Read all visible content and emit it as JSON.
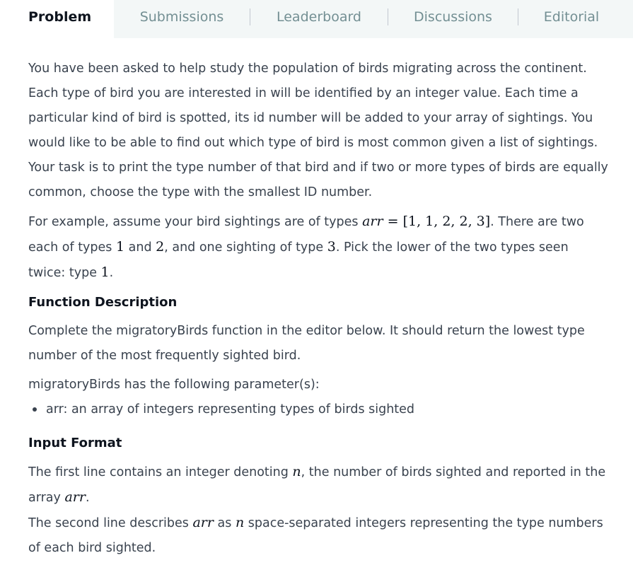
{
  "tabs": {
    "problem": "Problem",
    "submissions": "Submissions",
    "leaderboard": "Leaderboard",
    "discussions": "Discussions",
    "editorial": "Editorial"
  },
  "statement": {
    "intro": "You have been asked to help study the population of birds migrating across the continent. Each type of bird you are interested in will be identified by an integer value. Each time a particular kind of bird is spotted, its id number will be added to your array of sightings. You would like to be able to find out which type of bird is most common given a list of sightings. Your task is to print the type number of that bird and if two or more types of birds are equally common, choose the type with the smallest ID number.",
    "example": {
      "t1": "For example, assume your bird sightings are of types ",
      "var_arr": "arr",
      "eq": " = ",
      "arr_value": "[1, 1, 2, 2, 3]",
      "t2": ". There are two each of types ",
      "n1": "1",
      "t3": " and ",
      "n2": "2",
      "t4": ", and one sighting of type ",
      "n3": "3",
      "t5": ". Pick the lower of the two types seen twice: type ",
      "n4": "1",
      "t6": "."
    }
  },
  "function_description": {
    "heading": "Function Description",
    "text": "Complete the migratoryBirds function in the editor below. It should return the lowest type number of the most frequently sighted bird.",
    "params_intro": "migratoryBirds has the following parameter(s):",
    "params": [
      "arr: an array of integers representing types of birds sighted"
    ]
  },
  "input_format": {
    "heading": "Input Format",
    "line1_a": "The first line contains an integer denoting ",
    "line1_var_n": "n",
    "line1_b": ", the number of birds sighted and reported in the array ",
    "line1_var_arr": "arr",
    "line1_c": ".",
    "line2_a": "The second line describes ",
    "line2_var_arr": "arr",
    "line2_b": " as ",
    "line2_var_n": "n",
    "line2_c": " space-separated integers representing the type numbers of each bird sighted."
  }
}
